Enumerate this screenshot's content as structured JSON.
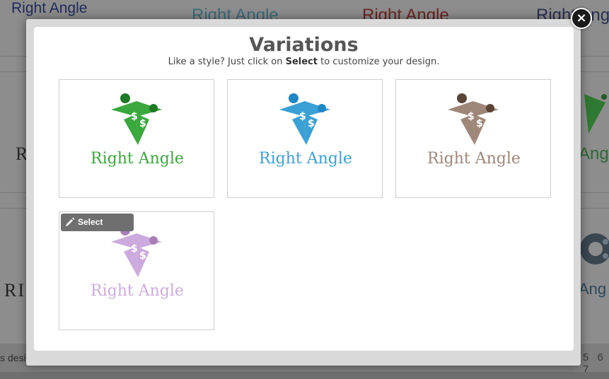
{
  "background": {
    "top_logo_texts": [
      "Right Angle",
      "Right Angle",
      "Right Angle",
      "Right Angle"
    ],
    "side_texts": [
      "Ri",
      "Ang",
      "RIG",
      "Ang"
    ],
    "footer_text": "s desi",
    "pagination": "5 6 7"
  },
  "modal": {
    "title": "Variations",
    "subtitle_prefix": "Like a style? Just click on",
    "subtitle_bold": "Select",
    "subtitle_suffix": "to customize your design.",
    "select_label": "Select",
    "close_glyph": "×"
  },
  "variations": [
    {
      "brand": "Right Angle",
      "primary_color": "#3aa83d",
      "dot_color": "#1f7a28",
      "text_color": "#3aa83d"
    },
    {
      "brand": "Right Angle",
      "primary_color": "#3ba0d6",
      "dot_color": "#1f86c4",
      "text_color": "#3ba0d6"
    },
    {
      "brand": "Right Angle",
      "primary_color": "#9e8779",
      "dot_color": "#5b4436",
      "text_color": "#9e8779"
    },
    {
      "brand": "Right Angle",
      "primary_color": "#b98ad0",
      "dot_color": "#8a4f9e",
      "text_color": "#b98ad0"
    }
  ]
}
